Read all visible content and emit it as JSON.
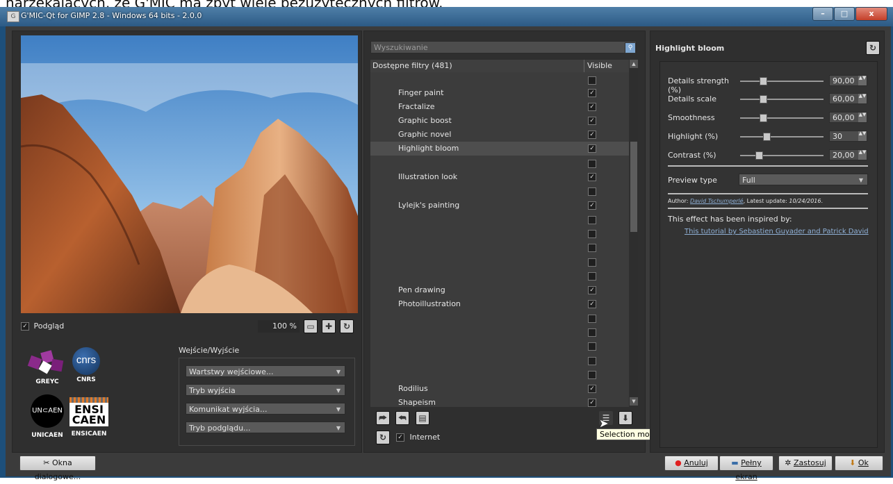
{
  "caption_text": "narzekających, że G'MIC ma zbyt wiele bezużytecznych filtrów.",
  "window": {
    "title": "G'MIC-Qt for GIMP 2.8 - Windows 64 bits - 2.0.0"
  },
  "preview": {
    "checkbox_label": "Podgląd",
    "zoom": "100 %"
  },
  "logos": [
    "GREYC",
    "CNRS",
    "UNICAEN",
    "ENSICAEN"
  ],
  "logo_text": {
    "cnrs": "cnrs",
    "unicaen": "UNICAEN",
    "ensi": "ENSI",
    "caen": "CAEN"
  },
  "io": {
    "title": "Wejście/Wyjście",
    "dropdowns": [
      "Wartstwy wejściowe...",
      "Tryb wyjścia",
      "Komunikat wyjścia...",
      "Tryb podglądu..."
    ]
  },
  "dialog_button": "Okna dialogowe...",
  "filters": {
    "search_placeholder": "Wyszukiwanie",
    "header": "Dostępne filtry (481)",
    "visible_col": "Visible",
    "rows": [
      {
        "name": "Finger paint",
        "checked": true
      },
      {
        "name": "Fractalize",
        "checked": true
      },
      {
        "name": "Graphic boost",
        "checked": true
      },
      {
        "name": "Graphic novel",
        "checked": true
      },
      {
        "name": "Highlight bloom",
        "checked": true
      },
      {
        "name": "Illustration look",
        "checked": true
      },
      {
        "name": "Lylejk's painting",
        "checked": true
      },
      {
        "name": "Pen drawing",
        "checked": true
      },
      {
        "name": "Photoillustration",
        "checked": true
      },
      {
        "name": "Rodilius",
        "checked": true
      },
      {
        "name": "Shapeism",
        "checked": true
      }
    ],
    "internet_label": "Internet",
    "tooltip": "Selection mode"
  },
  "settings": {
    "title": "Highlight bloom",
    "params": [
      {
        "label": "Details strength (%)",
        "value": "90,00",
        "fraction": 0.25
      },
      {
        "label": "Details scale",
        "value": "60,00",
        "fraction": 0.25
      },
      {
        "label": "Smoothness",
        "value": "60,00",
        "fraction": 0.25
      },
      {
        "label": "Highlight (%)",
        "value": "30",
        "fraction": 0.3
      },
      {
        "label": "Contrast (%)",
        "value": "20,00",
        "fraction": 0.2
      }
    ],
    "preview_type_label": "Preview type",
    "preview_type_value": "Full",
    "author_prefix": "Author:",
    "author_name": "David Tschumperlé",
    "latest_update_label": "Latest update:",
    "latest_update": "10/24/2016",
    "inspired_label": "This effect has been inspired by:",
    "inspired_link": "This tutorial by Sebastien Guyader and Patrick David"
  },
  "bottom_buttons": {
    "cancel": "Anuluj",
    "fullscreen": "Pełny ekran",
    "apply": "Zastosuj",
    "ok": "Ok"
  },
  "colors": {
    "panel": "#2f2f2f",
    "window_frame": "#1d4f7a",
    "cancel_icon": "#e02020",
    "link": "#8fb0d6"
  }
}
